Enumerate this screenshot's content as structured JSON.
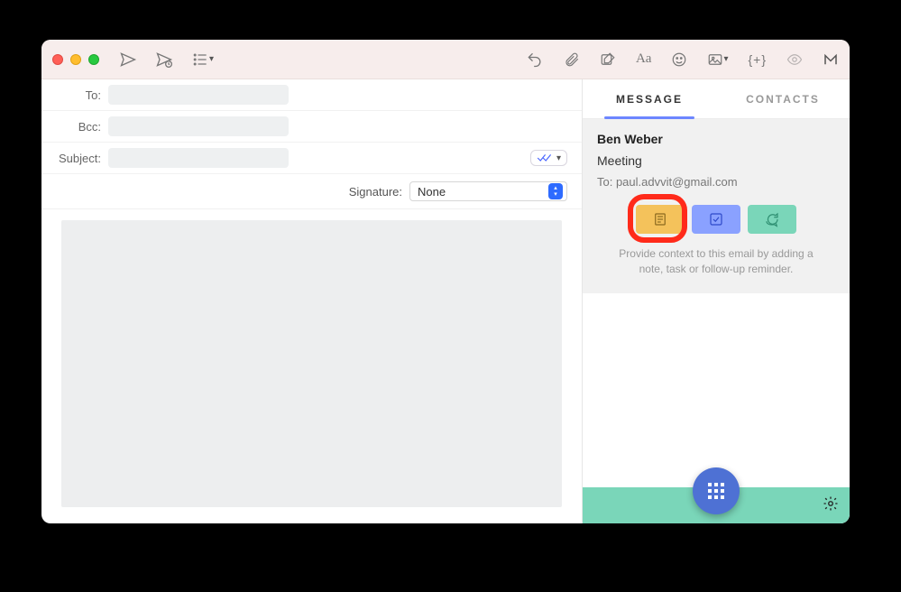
{
  "toolbar": {},
  "compose": {
    "to_label": "To:",
    "bcc_label": "Bcc:",
    "subject_label": "Subject:",
    "signature_label": "Signature:",
    "signature_value": "None"
  },
  "sidebar": {
    "tabs": {
      "message": "Message",
      "contacts": "Contacts"
    },
    "from_name": "Ben Weber",
    "subject": "Meeting",
    "to_line": "To: paul.advvit@gmail.com",
    "context_hint": "Provide context to this email by adding a note, task or follow-up reminder."
  }
}
